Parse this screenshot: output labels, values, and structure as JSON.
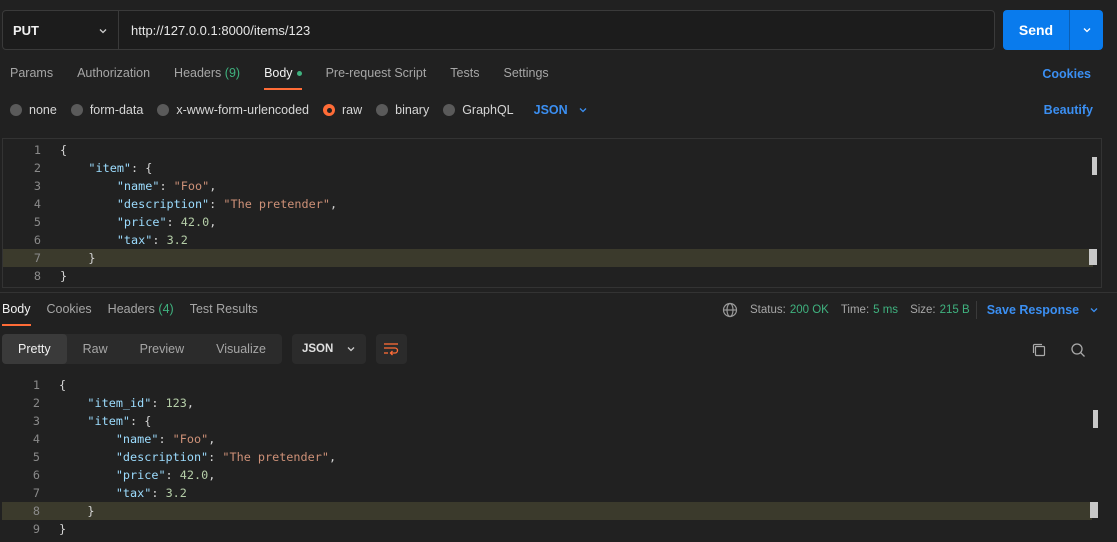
{
  "request": {
    "method": "PUT",
    "url": "http://127.0.0.1:8000/items/123",
    "send_label": "Send"
  },
  "request_tabs": [
    {
      "label": "Params"
    },
    {
      "label": "Authorization"
    },
    {
      "label": "Headers",
      "count": "(9)"
    },
    {
      "label": "Body"
    },
    {
      "label": "Pre-request Script"
    },
    {
      "label": "Tests"
    },
    {
      "label": "Settings"
    }
  ],
  "cookies_label": "Cookies",
  "body_types": [
    "none",
    "form-data",
    "x-www-form-urlencoded",
    "raw",
    "binary",
    "GraphQL"
  ],
  "selected_body_type": "raw",
  "raw_format": "JSON",
  "beautify_label": "Beautify",
  "request_body_lines": [
    {
      "n": "1",
      "text": "{"
    },
    {
      "n": "2",
      "text": "    \"item\": {"
    },
    {
      "n": "3",
      "text": "        \"name\": \"Foo\","
    },
    {
      "n": "4",
      "text": "        \"description\": \"The pretender\","
    },
    {
      "n": "5",
      "text": "        \"price\": 42.0,"
    },
    {
      "n": "6",
      "text": "        \"tax\": 3.2"
    },
    {
      "n": "7",
      "text": "    }"
    },
    {
      "n": "8",
      "text": "}"
    }
  ],
  "response_tabs": [
    {
      "label": "Body"
    },
    {
      "label": "Cookies"
    },
    {
      "label": "Headers",
      "count": "(4)"
    },
    {
      "label": "Test Results"
    }
  ],
  "response_status": {
    "status_label": "Status:",
    "status_value": "200 OK",
    "time_label": "Time:",
    "time_value": "5 ms",
    "size_label": "Size:",
    "size_value": "215 B",
    "save_label": "Save Response"
  },
  "view_modes": [
    "Pretty",
    "Raw",
    "Preview",
    "Visualize"
  ],
  "response_format": "JSON",
  "response_body_lines": [
    {
      "n": "1",
      "text": "{"
    },
    {
      "n": "2",
      "text": "    \"item_id\": 123,"
    },
    {
      "n": "3",
      "text": "    \"item\": {"
    },
    {
      "n": "4",
      "text": "        \"name\": \"Foo\","
    },
    {
      "n": "5",
      "text": "        \"description\": \"The pretender\","
    },
    {
      "n": "6",
      "text": "        \"price\": 42.0,"
    },
    {
      "n": "7",
      "text": "        \"tax\": 3.2"
    },
    {
      "n": "8",
      "text": "    }"
    },
    {
      "n": "9",
      "text": "}"
    }
  ],
  "colors": {
    "accent": "#ff6c37",
    "link": "#3b8ff2",
    "send": "#097bed",
    "success": "#3fb27f"
  }
}
